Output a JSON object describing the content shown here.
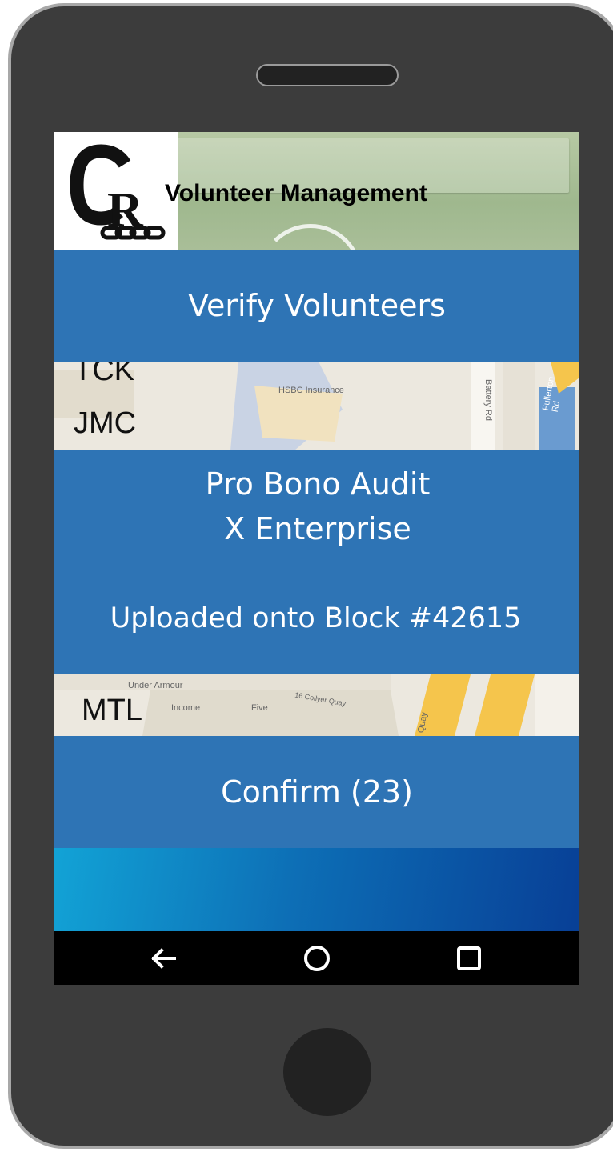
{
  "app": {
    "title": "Volunteer Management",
    "logo_text": "CR"
  },
  "header": {
    "verify_label": "Verify Volunteers"
  },
  "map_labels": {
    "top": [
      "TCK",
      "JMC"
    ],
    "bottom": [
      "MTL"
    ],
    "poi": [
      "HSBC Insurance",
      "Battery Rd",
      "Fullerton Rd",
      "Under Armour",
      "Income",
      "Five",
      "16 Collyer Quay",
      "Quay"
    ]
  },
  "record": {
    "line1": "Pro Bono Audit",
    "line2": "X Enterprise",
    "status": "Uploaded onto Block #42615"
  },
  "confirm": {
    "label": "Confirm (23)"
  },
  "nav": {
    "back": "back-icon",
    "home": "home-icon",
    "recents": "recents-icon"
  },
  "colors": {
    "accent": "#2e74b5",
    "phone_body": "#3c3c3c",
    "nav_bar": "#000000"
  }
}
